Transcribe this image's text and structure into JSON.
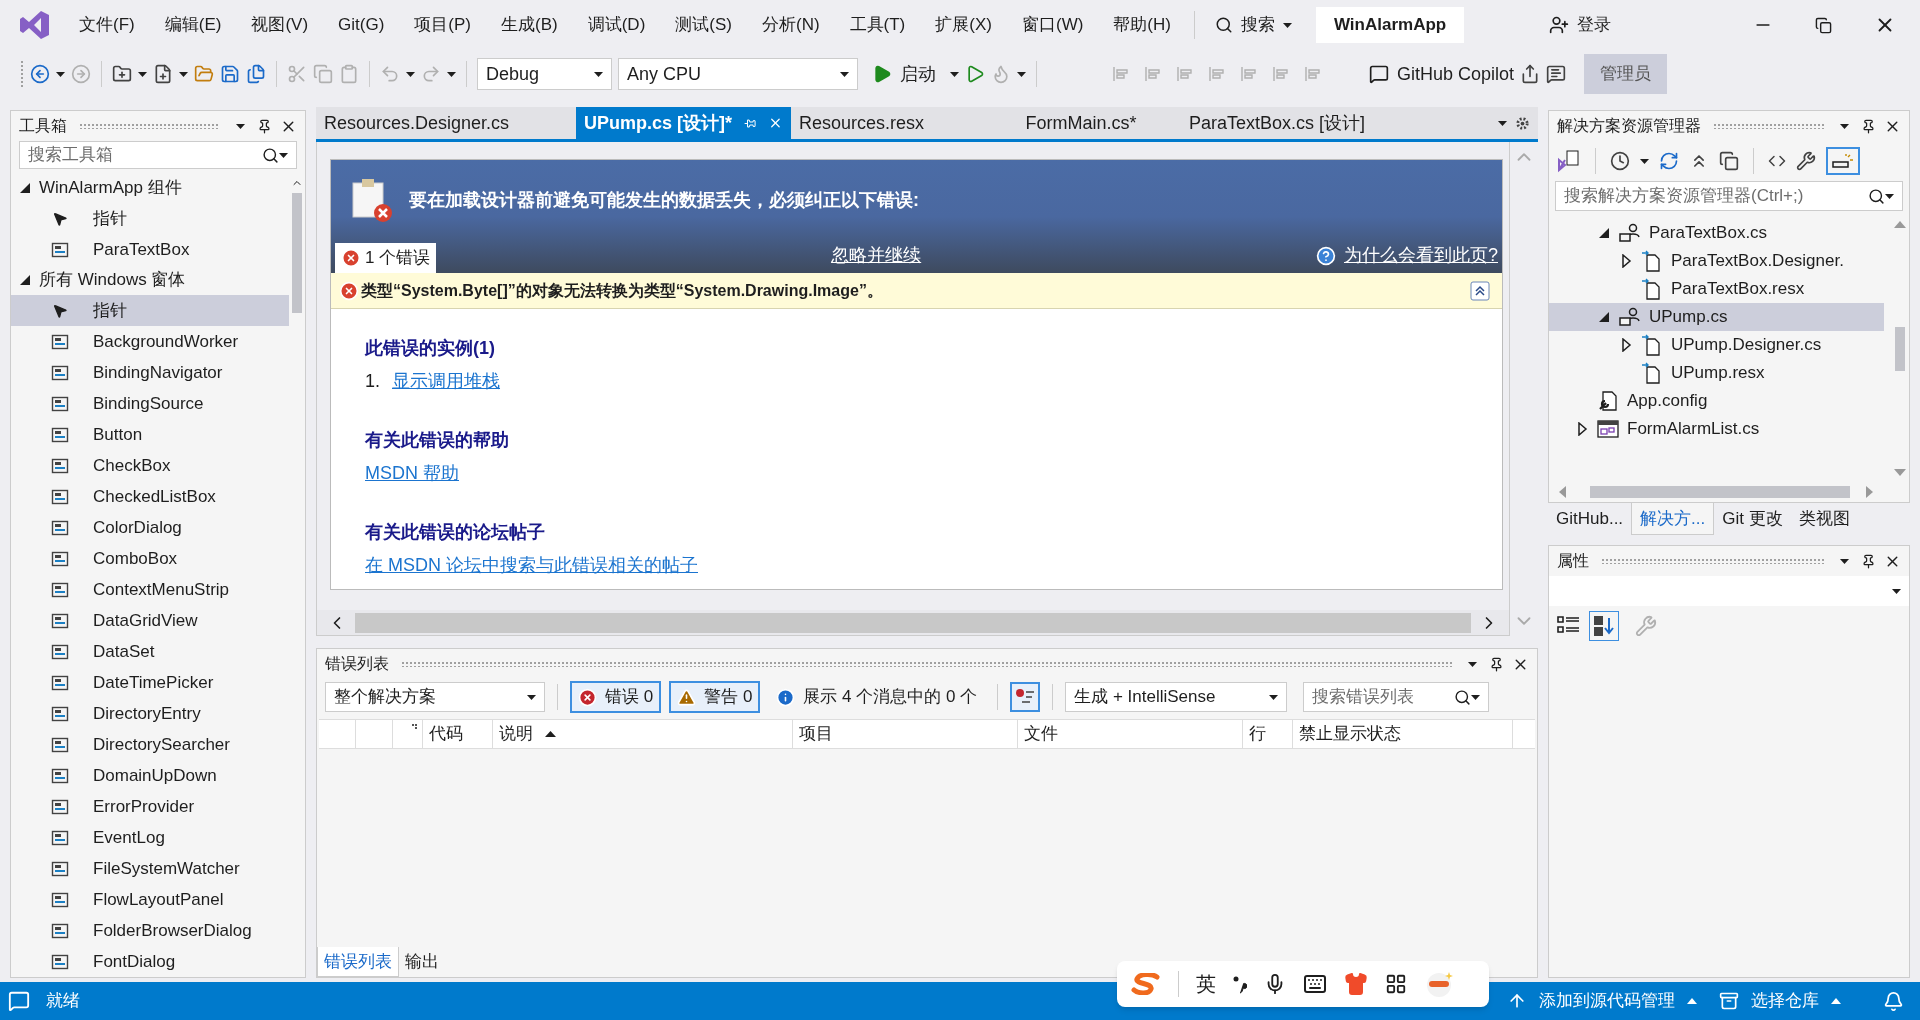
{
  "menu": [
    "文件(F)",
    "编辑(E)",
    "视图(V)",
    "Git(G)",
    "项目(P)",
    "生成(B)",
    "调试(D)",
    "测试(S)",
    "分析(N)",
    "工具(T)",
    "扩展(X)",
    "窗口(W)",
    "帮助(H)"
  ],
  "search_label": "搜索",
  "solution_name": "WinAlarmApp",
  "login": "登录",
  "toolbar": {
    "configuration": "Debug",
    "platform": "Any CPU",
    "start": "启动",
    "copilot": "GitHub Copilot",
    "admin": "管理员"
  },
  "toolbox": {
    "title": "工具箱",
    "search_placeholder": "搜索工具箱",
    "groups": [
      {
        "label": "WinAlarmApp 组件",
        "expanded": true,
        "items": [
          {
            "kind": "pointer",
            "label": "指针",
            "selected": false
          },
          {
            "kind": "component",
            "label": "ParaTextBox",
            "selected": false
          }
        ]
      },
      {
        "label": "所有 Windows 窗体",
        "expanded": true,
        "items": [
          {
            "kind": "pointer",
            "label": "指针",
            "selected": true
          },
          {
            "kind": "component",
            "label": "BackgroundWorker",
            "selected": false
          },
          {
            "kind": "component",
            "label": "BindingNavigator",
            "selected": false
          },
          {
            "kind": "component",
            "label": "BindingSource",
            "selected": false
          },
          {
            "kind": "component",
            "label": "Button",
            "selected": false
          },
          {
            "kind": "component",
            "label": "CheckBox",
            "selected": false
          },
          {
            "kind": "component",
            "label": "CheckedListBox",
            "selected": false
          },
          {
            "kind": "component",
            "label": "ColorDialog",
            "selected": false
          },
          {
            "kind": "component",
            "label": "ComboBox",
            "selected": false
          },
          {
            "kind": "component",
            "label": "ContextMenuStrip",
            "selected": false
          },
          {
            "kind": "component",
            "label": "DataGridView",
            "selected": false
          },
          {
            "kind": "component",
            "label": "DataSet",
            "selected": false
          },
          {
            "kind": "component",
            "label": "DateTimePicker",
            "selected": false
          },
          {
            "kind": "component",
            "label": "DirectoryEntry",
            "selected": false
          },
          {
            "kind": "component",
            "label": "DirectorySearcher",
            "selected": false
          },
          {
            "kind": "component",
            "label": "DomainUpDown",
            "selected": false
          },
          {
            "kind": "component",
            "label": "ErrorProvider",
            "selected": false
          },
          {
            "kind": "component",
            "label": "EventLog",
            "selected": false
          },
          {
            "kind": "component",
            "label": "FileSystemWatcher",
            "selected": false
          },
          {
            "kind": "component",
            "label": "FlowLayoutPanel",
            "selected": false
          },
          {
            "kind": "component",
            "label": "FolderBrowserDialog",
            "selected": false
          },
          {
            "kind": "component",
            "label": "FontDialog",
            "selected": false
          }
        ]
      }
    ]
  },
  "tabs": [
    {
      "label": "Resources.Designer.cs",
      "selected": false
    },
    {
      "label": "UPump.cs [设计]*",
      "selected": true
    },
    {
      "label": "Resources.resx",
      "selected": false
    },
    {
      "label": "FormMain.cs*",
      "selected": false
    },
    {
      "label": "ParaTextBox.cs [设计]",
      "selected": false
    }
  ],
  "designer": {
    "banner": "要在加载设计器前避免可能发生的数据丢失，必须纠正以下错误:",
    "error_count": "1 个错误",
    "ignore_link": "忽略并继续",
    "why_link": "为什么会看到此页?",
    "error_message": "类型“System.Byte[]”的对象无法转换为类型“System.Drawing.Image”。",
    "sections": [
      {
        "heading": "此错误的实例(1)",
        "number": "1.",
        "link": "显示调用堆栈"
      },
      {
        "heading": "有关此错误的帮助",
        "link": "MSDN 帮助"
      },
      {
        "heading": "有关此错误的论坛帖子",
        "link": "在 MSDN 论坛中搜索与此错误相关的帖子"
      }
    ]
  },
  "error_list": {
    "title": "错误列表",
    "scope": "整个解决方案",
    "filters": [
      {
        "kind": "error",
        "label": "错误 0",
        "selected": true
      },
      {
        "kind": "warning",
        "label": "警告 0",
        "selected": true
      },
      {
        "kind": "message",
        "label": "展示 4 个消息中的 0 个",
        "selected": false
      }
    ],
    "source": "生成 + IntelliSense",
    "search_placeholder": "搜索错误列表",
    "columns": [
      {
        "label": "代码",
        "sorted": false
      },
      {
        "label": "说明",
        "sorted": true
      },
      {
        "label": "项目",
        "sorted": false
      },
      {
        "label": "文件",
        "sorted": false
      },
      {
        "label": "行",
        "sorted": false
      },
      {
        "label": "禁止显示状态",
        "sorted": false
      }
    ],
    "bottom_tabs": [
      {
        "label": "错误列表",
        "selected": true
      },
      {
        "label": "输出",
        "selected": false
      }
    ]
  },
  "solution_explorer": {
    "title": "解决方案资源管理器",
    "search_placeholder": "搜索解决方案资源管理器(Ctrl+;)",
    "tree": [
      {
        "children": [
          {
            "kind": "usercontrol",
            "label": "ParaTextBox.cs",
            "expanded": true,
            "selected": false,
            "children": [
              {
                "kind": "code",
                "label": "ParaTextBox.Designer.",
                "expanded": false,
                "selected": false
              },
              {
                "kind": "code",
                "label": "ParaTextBox.resx",
                "selected": false
              }
            ]
          },
          {
            "kind": "usercontrol",
            "label": "UPump.cs",
            "expanded": true,
            "selected": true,
            "children": [
              {
                "kind": "code",
                "label": "UPump.Designer.cs",
                "expanded": false,
                "selected": false
              },
              {
                "kind": "code",
                "label": "UPump.resx",
                "selected": false
              }
            ]
          }
        ]
      },
      {
        "kind": "config",
        "label": "App.config",
        "selected": false
      },
      {
        "kind": "form",
        "label": "FormAlarmList.cs",
        "expanded": false,
        "selected": false
      }
    ]
  },
  "side_tabs": [
    {
      "label": "GitHub...",
      "selected": false
    },
    {
      "label": "解决方...",
      "selected": true
    },
    {
      "label": "Git 更改",
      "selected": false
    },
    {
      "label": "类视图",
      "selected": false
    }
  ],
  "properties": {
    "title": "属性"
  },
  "status_bar": {
    "ready": "就绪",
    "source_control": "添加到源代码管理",
    "repository": "选择仓库"
  },
  "ime": {
    "language": "英"
  }
}
